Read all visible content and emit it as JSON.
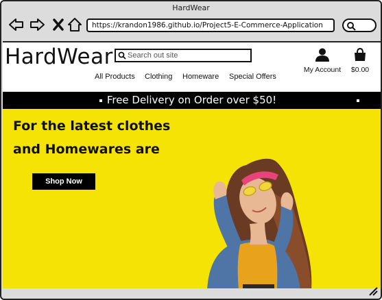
{
  "window": {
    "title": "HardWear"
  },
  "browser": {
    "url": "https://krandon1986.github.io/Project5-E-Commerce-Application",
    "icons": [
      "back-arrow-icon",
      "forward-arrow-icon",
      "close-icon",
      "home-icon",
      "search-icon"
    ]
  },
  "site": {
    "logo": "HardWear",
    "search_placeholder": "Search out site",
    "account_label": "My Account",
    "cart_total": "$0.00",
    "nav": [
      "All Products",
      "Clothing",
      "Homeware",
      "Special Offers"
    ],
    "promo": "Free Delivery on Order over $50!",
    "hero": {
      "line1": "For the latest clothes",
      "line2": "and Homewares are",
      "button": "Shop Now"
    }
  },
  "colors": {
    "hero_bg": "#f5e305",
    "promo_bg": "#000000",
    "sweater": "#e8a21c",
    "jacket": "#4f74a6"
  }
}
